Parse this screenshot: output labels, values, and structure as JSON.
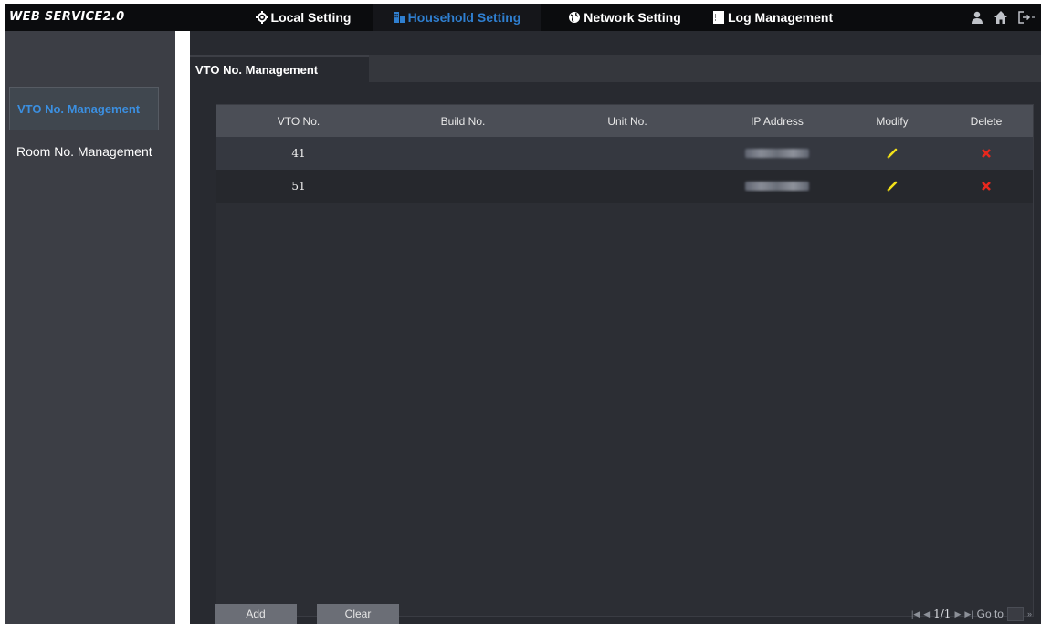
{
  "app": {
    "logo": "WEB SERVICE2.0"
  },
  "nav": {
    "tabs": [
      {
        "label": "Local Setting",
        "icon": "gear-icon"
      },
      {
        "label": "Household Setting",
        "icon": "building-icon",
        "active": true
      },
      {
        "label": "Network Setting",
        "icon": "globe-icon"
      },
      {
        "label": "Log Management",
        "icon": "document-icon"
      }
    ],
    "right_icons": [
      "user-icon",
      "home-icon",
      "logout-icon"
    ]
  },
  "sidebar": {
    "items": [
      {
        "label": "VTO No. Management",
        "active": true
      },
      {
        "label": "Room No. Management",
        "active": false
      }
    ]
  },
  "main": {
    "tab_label": "VTO No. Management",
    "table": {
      "headers": [
        "VTO No.",
        "Build No.",
        "Unit No.",
        "IP Address",
        "Modify",
        "Delete"
      ],
      "rows": [
        {
          "vto": "41",
          "build": "",
          "unit": "",
          "ip": "(obscured)"
        },
        {
          "vto": "51",
          "build": "",
          "unit": "",
          "ip": "(obscured)"
        }
      ]
    },
    "buttons": {
      "add": "Add",
      "clear": "Clear"
    },
    "pager": {
      "first": "⏮",
      "prev": "◀",
      "page": "1/1",
      "next": "▶",
      "last": "⏭",
      "goto_label": "Go to",
      "go": "»"
    }
  },
  "colors": {
    "accent": "#2f7fd0",
    "modify": "#f2e11a",
    "delete": "#e8281e"
  }
}
